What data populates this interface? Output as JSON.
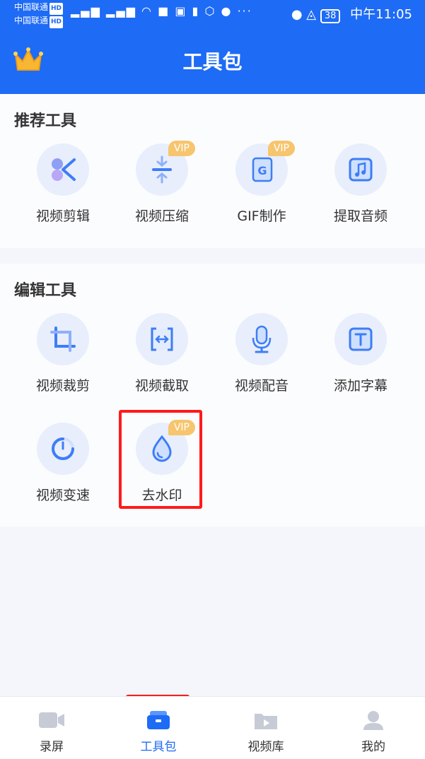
{
  "status_bar": {
    "carrier1": "中国联通",
    "carrier2": "中国联通",
    "hd": "HD",
    "battery": "38",
    "time": "中午11:05"
  },
  "header": {
    "title": "工具包"
  },
  "recommend": {
    "title": "推荐工具",
    "tools": [
      {
        "label": "视频剪辑",
        "icon": "scissors-icon",
        "vip": ""
      },
      {
        "label": "视频压缩",
        "icon": "compress-icon",
        "vip": "VIP"
      },
      {
        "label": "GIF制作",
        "icon": "gif-icon",
        "vip": "VIP"
      },
      {
        "label": "提取音频",
        "icon": "music-icon",
        "vip": ""
      }
    ]
  },
  "edit": {
    "title": "编辑工具",
    "tools": [
      {
        "label": "视频裁剪",
        "icon": "crop-icon",
        "vip": ""
      },
      {
        "label": "视频截取",
        "icon": "trim-icon",
        "vip": ""
      },
      {
        "label": "视频配音",
        "icon": "microphone-icon",
        "vip": ""
      },
      {
        "label": "添加字幕",
        "icon": "subtitle-icon",
        "vip": ""
      },
      {
        "label": "视频变速",
        "icon": "speed-icon",
        "vip": ""
      },
      {
        "label": "去水印",
        "icon": "watermark-drop-icon",
        "vip": "VIP"
      }
    ]
  },
  "bottom_nav": [
    {
      "label": "录屏",
      "icon": "camera-icon",
      "active": false
    },
    {
      "label": "工具包",
      "icon": "toolbox-icon",
      "active": true
    },
    {
      "label": "视频库",
      "icon": "video-library-icon",
      "active": false
    },
    {
      "label": "我的",
      "icon": "profile-icon",
      "active": false
    }
  ],
  "colors": {
    "primary": "#1e6bf5",
    "vip": "#f6c56e",
    "highlight": "#ff1a1a"
  }
}
